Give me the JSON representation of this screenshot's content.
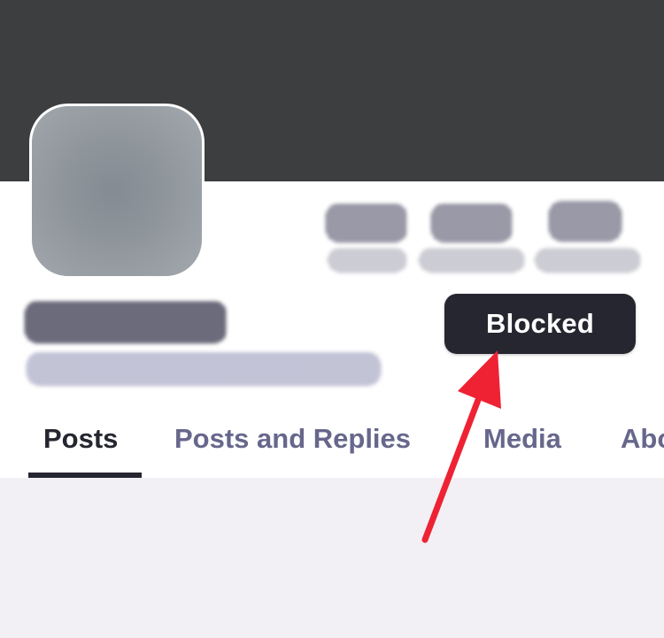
{
  "profile": {
    "blocked_label": "Blocked"
  },
  "tabs": [
    {
      "label": "Posts",
      "active": true
    },
    {
      "label": "Posts and Replies",
      "active": false
    },
    {
      "label": "Media",
      "active": false
    },
    {
      "label": "About",
      "active": false
    }
  ],
  "colors": {
    "banner": "#3d3e40",
    "button_bg": "#252630",
    "tab_inactive": "#67678c",
    "annotation_arrow": "#ee2233"
  },
  "annotation": {
    "icon": "red-arrow-icon"
  }
}
